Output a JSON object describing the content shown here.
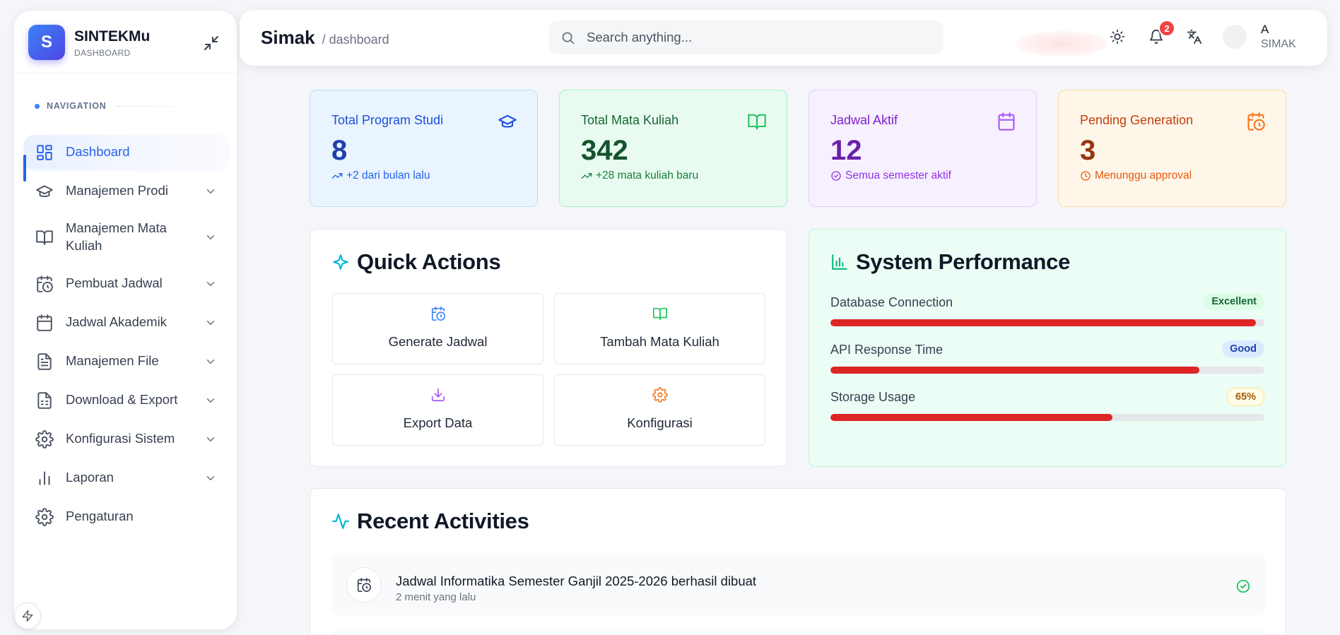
{
  "brand": {
    "logo_letter": "S",
    "name": "SINTEKMu",
    "subtitle": "DASHBOARD"
  },
  "sidebar": {
    "heading": "NAVIGATION",
    "items": [
      {
        "label": "Dashboard",
        "icon": "dashboard-icon",
        "active": true,
        "has_children": false
      },
      {
        "label": "Manajemen Prodi",
        "icon": "graduation-cap-icon",
        "has_children": true
      },
      {
        "label": "Manajemen Mata Kuliah",
        "icon": "book-open-icon",
        "has_children": true
      },
      {
        "label": "Pembuat Jadwal",
        "icon": "calendar-clock-icon",
        "has_children": true
      },
      {
        "label": "Jadwal Akademik",
        "icon": "calendar-icon",
        "has_children": true
      },
      {
        "label": "Manajemen File",
        "icon": "file-text-icon",
        "has_children": true
      },
      {
        "label": "Download & Export",
        "icon": "file-spreadsheet-icon",
        "has_children": true
      },
      {
        "label": "Konfigurasi Sistem",
        "icon": "gear-icon",
        "has_children": true
      },
      {
        "label": "Laporan",
        "icon": "bar-chart-icon",
        "has_children": true
      },
      {
        "label": "Pengaturan",
        "icon": "gear-icon",
        "has_children": false
      }
    ]
  },
  "header": {
    "title": "Simak",
    "breadcrumb": "/ dashboard",
    "search_placeholder": "Search anything...",
    "notification_count": "2",
    "user_name": "A",
    "user_role": "SIMAK"
  },
  "stats": [
    {
      "label": "Total Program Studi",
      "value": "8",
      "note": "+2 dari bulan lalu",
      "icon": "graduation-cap-icon",
      "color": "#1d4ed8"
    },
    {
      "label": "Total Mata Kuliah",
      "value": "342",
      "note": "+28 mata kuliah baru",
      "icon": "book-open-icon",
      "color": "#166534"
    },
    {
      "label": "Jadwal Aktif",
      "value": "12",
      "note": "Semua semester aktif",
      "icon": "calendar-icon",
      "color": "#7e22ce"
    },
    {
      "label": "Pending Generation",
      "value": "3",
      "note": "Menunggu approval",
      "icon": "calendar-clock-icon",
      "color": "#c2410c"
    }
  ],
  "quick_actions": {
    "title": "Quick Actions",
    "items": [
      {
        "label": "Generate Jadwal",
        "icon": "calendar-clock-icon",
        "color": "#3b82f6"
      },
      {
        "label": "Tambah Mata Kuliah",
        "icon": "book-open-icon",
        "color": "#22c55e"
      },
      {
        "label": "Export Data",
        "icon": "download-icon",
        "color": "#a855f7"
      },
      {
        "label": "Konfigurasi",
        "icon": "gear-icon",
        "color": "#f97316"
      }
    ]
  },
  "performance": {
    "title": "System Performance",
    "metrics": [
      {
        "label": "Database Connection",
        "status": "Excellent",
        "level_pct": 98,
        "badge_bg": "#dcfce7",
        "badge_color": "#166534"
      },
      {
        "label": "API Response Time",
        "status": "Good",
        "level_pct": 85,
        "badge_bg": "#dbeafe",
        "badge_color": "#1e40af"
      },
      {
        "label": "Storage Usage",
        "status": "65%",
        "level_pct": 65,
        "badge_bg": "#fefce8",
        "badge_color": "#a16207"
      }
    ]
  },
  "activities": {
    "title": "Recent Activities",
    "items": [
      {
        "title": "Jadwal Informatika Semester Ganjil 2025-2026 berhasil dibuat",
        "time": "2 menit yang lalu",
        "icon": "calendar-clock-icon",
        "status_icon": "check-circle-icon"
      }
    ]
  }
}
